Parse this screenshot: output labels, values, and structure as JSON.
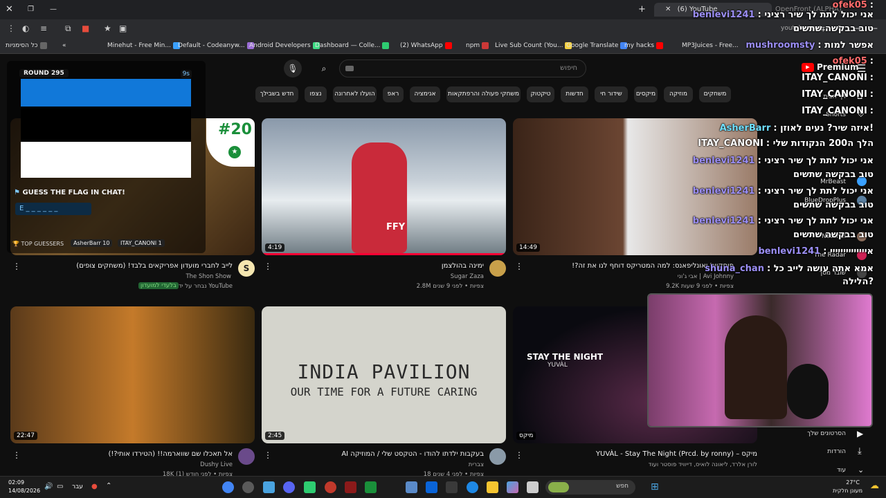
{
  "browser": {
    "tabs": [
      {
        "label": "(6) YouTube"
      },
      {
        "label": "OpenFront (ALPHA)"
      }
    ],
    "new_tab": "+",
    "address": "youtube.com",
    "bookmarks": [
      {
        "label": "כל הסימניות",
        "color": "#888"
      },
      {
        "label": "Minehut - Free Min...",
        "color": "#3aa0ff"
      },
      {
        "label": "Default - Codeanyw...",
        "color": "#9b6dd6"
      },
      {
        "label": "Android Developers",
        "color": "#3ddc84"
      },
      {
        "label": "Dashboard — Colle...",
        "color": "#2ecc71"
      },
      {
        "label": "(2) WhatsApp",
        "color": "#ff0000"
      },
      {
        "label": "npm",
        "color": "#ff0000"
      },
      {
        "label": "Live Sub Count (You...",
        "color": "#cb3837"
      },
      {
        "label": "Google Translate",
        "color": "#f4d03f"
      },
      {
        "label": "my hacks",
        "color": "#4285f4"
      },
      {
        "label": "MP3Juices - Free...",
        "color": "#ff0000"
      }
    ]
  },
  "youtube": {
    "brand": "Premium",
    "search_placeholder": "חיפוש",
    "chips": [
      "חדש בשבילך",
      "נצפו",
      "הועלו לאחרונה",
      "ראפ",
      "אנימציה",
      "משחקי פעולה והרפתקאות",
      "טיקטוק",
      "חדשות",
      "שידור חי",
      "מיקסים",
      "מוזיקה",
      "משחקים"
    ],
    "sidebar": {
      "items": [
        {
          "label": "דף הבית"
        },
        {
          "label": "Shorts"
        }
      ],
      "subscriptions": [
        "MrBeast",
        "BlueDropPlus",
        "Natanel",
        "The Radar",
        "שובר מסך"
      ],
      "bottom": [
        {
          "label": "הסרטונים שלך"
        },
        {
          "label": "הורדות"
        },
        {
          "label": "עוד"
        }
      ]
    },
    "videos": [
      {
        "title": "לייב לחברי מועדון אפריקאים בלבד! (משחקים צופים)",
        "channel": "The Shon Show",
        "meta": "נבחר על ידי YouTube",
        "badge": "בלעדי למועדון",
        "thumb_text": "#20"
      },
      {
        "title": "ימינה בהולצמן",
        "channel": "Sugar Zaza",
        "meta": "2.8M צפיות • לפני 9 שנים",
        "duration": "4:19",
        "thumb_text": "FFY"
      },
      {
        "title": "פוסקויג' ואונליפאנס: למה המטריקס דוחף לנו את זה?!",
        "channel": "אבי ג'וני | Avi Johnny",
        "meta": "9.2K צפיות • לפני 9 שעות",
        "duration": "14:49"
      },
      {
        "title": "אל תאכלו שם שווארמה!! (הטירדו אותי?!)",
        "channel": "Dushy Live",
        "meta": "18K צפיות • לפני חודש (1)",
        "duration": "22:47"
      },
      {
        "title": "בעקבות ילדתו להודו - הטקסט שלי / המוזיקה AI",
        "channel": "צברית",
        "meta": "18 צפיות • לפני 4 שנים",
        "duration": "2:45",
        "thumb_title": "INDIA PAVILION",
        "thumb_subtitle": "OUR TIME FOR A FUTURE CARING"
      },
      {
        "title": "מיקס – YUVÀL - Stay The Night (Prcd. by ronny)",
        "channel": "לורן אלרד, ליאונה לואיס, דייוויד פוסטר ועוד",
        "duration": "מיקס",
        "thumb_title": "STAY THE NIGHT",
        "thumb_subtitle": "YUVÀL"
      }
    ]
  },
  "game": {
    "round": "ROUND 295",
    "timer": "9s",
    "prompt": "GUESS THE FLAG IN CHAT!",
    "hint": "E _ _ _ _ _ _",
    "top_label": "TOP GUESSERS",
    "guessers": [
      "AsherBarr 10",
      "ITAY_CANONI 1"
    ],
    "flag_colors": [
      "#1178d9",
      "#000000",
      "#ffffff"
    ]
  },
  "chat": [
    {
      "user": "ofek05",
      "text": ":"
    },
    {
      "user": "benlevi1241",
      "text": ": אני יכול לתת לך שיר רציני"
    },
    {
      "user": "",
      "text": "טוב בבקשה שתשים"
    },
    {
      "user": "mushroomsty",
      "text": ": אפשר למות"
    },
    {
      "user": "ofek05",
      "text": ":"
    },
    {
      "user": "ITAY_CANONI",
      "text": ":"
    },
    {
      "user": "ITAY_CANONI",
      "text": ":"
    },
    {
      "user": "ITAY_CANONI",
      "text": ":"
    },
    {
      "user": "AsherBarr",
      "text": ": איזה שיר? נעים לאוזן!"
    },
    {
      "user": "ITAY_CANONI",
      "text": ": הלך ה200 הנקודות שלי"
    },
    {
      "user": "benlevi1241",
      "text": ": אני יכול לתת לך שיר רציני"
    },
    {
      "user": "",
      "text": "טוב בבקשה שתשים"
    },
    {
      "user": "benlevi1241",
      "text": ": אני יכול לתת לך שיר רציני"
    },
    {
      "user": "",
      "text": "טוב בבקשה שתשים"
    },
    {
      "user": "benlevi1241",
      "text": ": אני יכול לתת לך שיר רציני"
    },
    {
      "user": "",
      "text": "טוב בבקשה שתשים"
    },
    {
      "user": "benlevi1241",
      "text": ": איייייייייייייי"
    },
    {
      "user": "shuna_chan",
      "text": ": אמא אתה עושה לייב כל"
    },
    {
      "user": "",
      "text": "הלילה?"
    }
  ],
  "taskbar": {
    "time": "02:09",
    "date": "14/08/2026",
    "lang": "עבר",
    "search": "חפש",
    "weather_temp": "27°C",
    "weather_desc": "מעונן חלקית"
  }
}
